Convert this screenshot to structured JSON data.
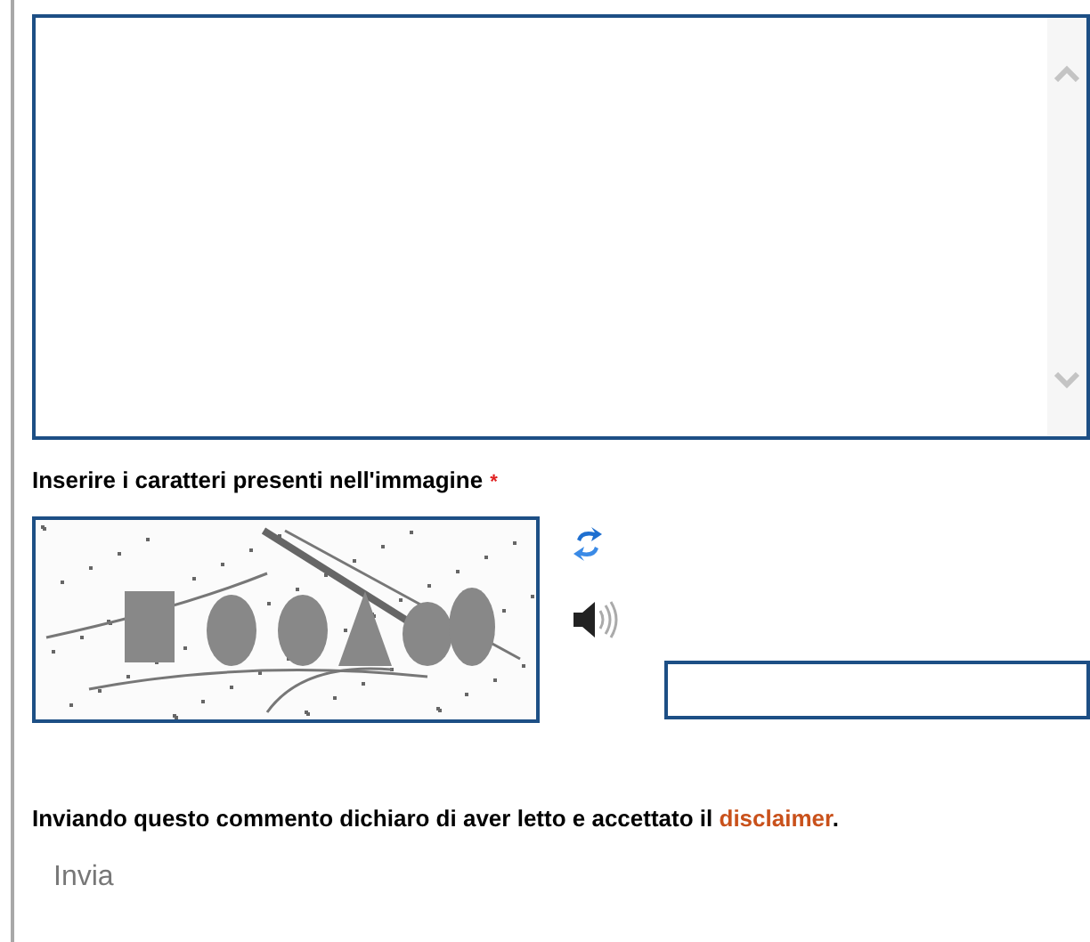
{
  "captcha": {
    "label": "Inserire i caratteri presenti nell'immagine",
    "required_mark": "*"
  },
  "disclaimer": {
    "text_before": "Inviando questo commento dichiaro di aver letto e accettato il ",
    "link": "disclaimer",
    "text_after": "."
  },
  "submit_button": {
    "label": "Invia"
  }
}
